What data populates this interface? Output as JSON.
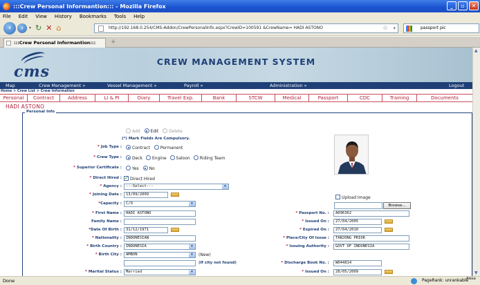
{
  "window": {
    "title": ":::Crew Personal Informantion::: - Mozilla Firefox"
  },
  "menu": [
    "File",
    "Edit",
    "View",
    "History",
    "Bookmarks",
    "Tools",
    "Help"
  ],
  "browser": {
    "url": "http://192.168.0.254/CMS-Addon/CrewPersonalInfo.aspx?CrewID=100591 &CrewName= HADI ASTONO",
    "search": "passport pic",
    "tab_title": ":::Crew Personal Informantion:::",
    "status": "Done",
    "pagerank": "PageRank: unrankable",
    "alexa": "Alexa"
  },
  "banner": {
    "logo": "CMS",
    "title": "CREW MANAGEMENT SYSTEM"
  },
  "nav": {
    "map": "Map",
    "crew": "Crew Management »",
    "vessel": "Vessel Management »",
    "payroll": "Payroll »",
    "admin": "Administration »",
    "logout": "Logout"
  },
  "breadcrumb": {
    "home": "Home",
    "crewlist": "Crew List",
    "info": "Crew Information"
  },
  "subtabs": [
    "Personal",
    "Contract",
    "Address",
    "LI & PI",
    "Diary",
    "Travel Exp.",
    "Bank",
    "STCW",
    "Medical",
    "Passport",
    "CDC",
    "Training",
    "Documents"
  ],
  "crew_name": "HADI ASTONO",
  "form": {
    "legend": "Personal Info",
    "mode": {
      "add": "Add",
      "edit": "Edit",
      "delete": "Delete"
    },
    "note": "(*) Mark Fields Are Compulsory.",
    "job_type": {
      "label": "Job Type :",
      "opt1": "Contract",
      "opt2": "Permanent"
    },
    "crew_type": {
      "label": "Crew Type :",
      "opt1": "Deck",
      "opt2": "Engine",
      "opt3": "Saloon",
      "opt4": "Riding Team"
    },
    "superior": {
      "label": "Superior Certificate :",
      "opt1": "Yes",
      "opt2": "No"
    },
    "direct_hired": {
      "label": "Direct Hired :",
      "text": "Direct Hired"
    },
    "agency": {
      "label": "Agency :",
      "value": "---Select---"
    },
    "joining_date": {
      "label": "Joining Date :",
      "value": "13/09/2009"
    },
    "capacity": {
      "label": "Capacity :",
      "value": "C/O"
    },
    "first_name": {
      "label": "First Name :",
      "value": "HADI ASTONO"
    },
    "family_name": {
      "label": "Family Name :",
      "value": ""
    },
    "dob": {
      "label": "Date Of Birth :",
      "value": "31/12/1971"
    },
    "nationality": {
      "label": "Nationality :",
      "value": "INDONESIAN"
    },
    "birth_country": {
      "label": "Birth Country :",
      "value": "INDONESIA"
    },
    "birth_city": {
      "label": "Birth City :",
      "value": "AMBON",
      "new": "(New)",
      "hint": "(If city not found)"
    },
    "marital": {
      "label": "Marital Status :",
      "value": "Married"
    },
    "upload": {
      "label": "Upload Image",
      "browse": "Browse..."
    },
    "passport_no": {
      "label": "Passport No. :",
      "value": "A096362"
    },
    "issued_on": {
      "label": "Issued On :",
      "value": "27/04/2005"
    },
    "expired_on": {
      "label": "Expired On :",
      "value": "27/04/2010"
    },
    "place_issue": {
      "label": "Place/City Of Issue :",
      "value": "TANJONG PRIOK"
    },
    "issuing_auth": {
      "label": "Issuing Authority :",
      "value": "GOVT OF INDONESIA"
    },
    "discharge": {
      "label": "Discharge Book No. :",
      "value": "W044814"
    },
    "issued_on2": {
      "label": "Issued On :",
      "value": "28/05/2009"
    }
  }
}
